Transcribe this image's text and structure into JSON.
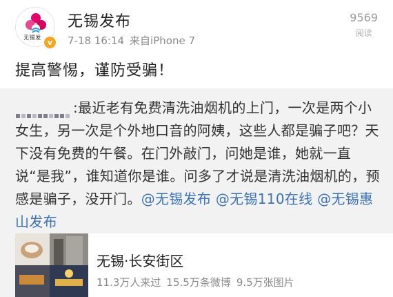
{
  "post": {
    "account_name": "无锡发布",
    "avatar_text": "无锡发",
    "verified_mark": "v",
    "date_time": "7-18 16:14",
    "source": "来自iPhone 7",
    "read_count": "9569",
    "read_label": "阅读",
    "text": "提高警惕，谨防受骗！"
  },
  "repost": {
    "body": "最近老有免费清洗油烟机的上门，一次是两个小女生，另一次是个外地口音的阿姨，这些人都是骗子吧？天下没有免费的午餐。在门外敲门，问她是谁，她就一直说“是我”，谁知道你是谁。问多了才说是清洗油烟机的，预感是骗子，没开门。",
    "separator": ":",
    "mentions": [
      "@无锡发布",
      "@无锡110在线",
      "@无锡惠山发布"
    ]
  },
  "location_card": {
    "title": "无锡·长安街区",
    "visitors": "11.3万人来过",
    "posts": "15.5万条微博",
    "photos": "9.5万张图片"
  }
}
